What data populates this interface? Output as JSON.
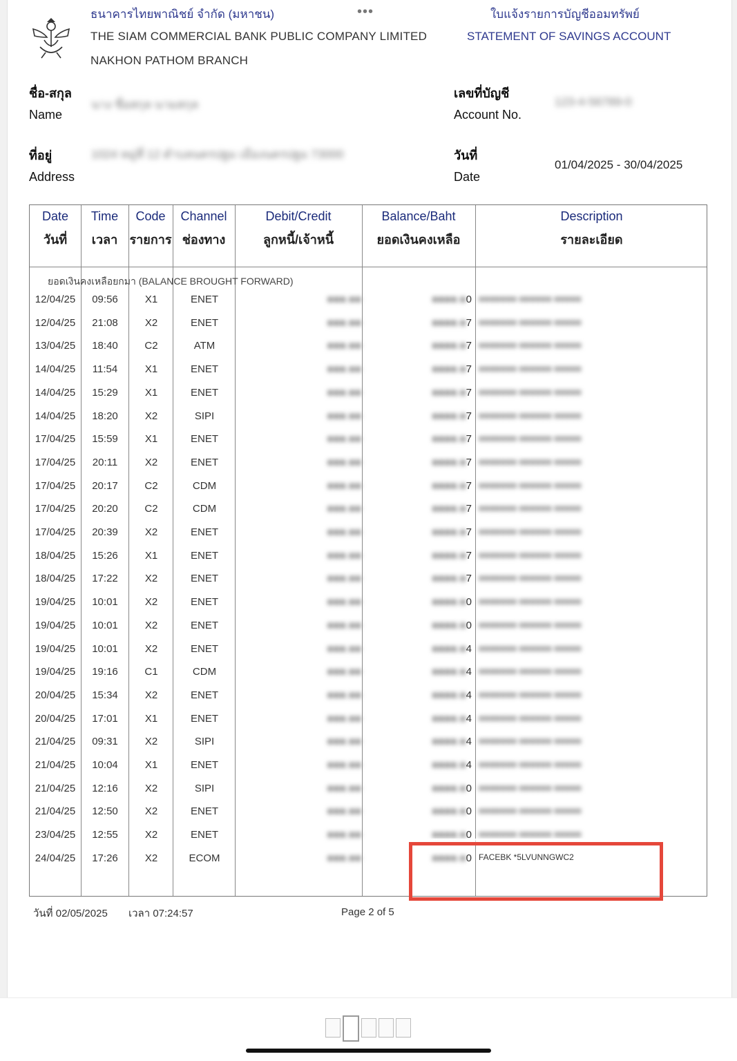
{
  "bank": {
    "name_th": "ธนาคารไทยพาณิชย์ จำกัด (มหาชน)",
    "name_en": "THE SIAM COMMERCIAL BANK PUBLIC COMPANY LIMITED",
    "branch": "NAKHON PATHOM BRANCH"
  },
  "doc_title": {
    "th": "ใบแจ้งรายการบัญชีออมทรัพย์",
    "en": "STATEMENT OF SAVINGS ACCOUNT"
  },
  "menu_dots": "•••",
  "labels": {
    "name_th": "ชื่อ-สกุล",
    "name_en": "Name",
    "address_th": "ที่อยู่",
    "address_en": "Address",
    "account_th": "เลขที่บัญชี",
    "account_en": "Account No.",
    "date_th": "วันที่",
    "date_en": "Date"
  },
  "values": {
    "name": "นาง ชื่อสกุล นามสกุล",
    "address": "1024 หมู่ที่ 12 ตำบลนครปฐม เมืองนครปฐม 73000",
    "account": "123-4-56789-0",
    "date_range": "01/04/2025 - 30/04/2025"
  },
  "table": {
    "headers": [
      {
        "en": "Date",
        "th": "วันที่"
      },
      {
        "en": "Time",
        "th": "เวลา"
      },
      {
        "en": "Code",
        "th": "รายการ"
      },
      {
        "en": "Channel",
        "th": "ช่องทาง"
      },
      {
        "en": "Debit/Credit",
        "th": "ลูกหนี้/เจ้าหนี้"
      },
      {
        "en": "Balance/Baht",
        "th": "ยอดเงินคงเหลือ"
      },
      {
        "en": "Description",
        "th": "รายละเอียด"
      }
    ],
    "brought_forward": "ยอดเงินคงเหลือยกมา (BALANCE BROUGHT FORWARD)",
    "rows": [
      {
        "date": "12/04/25",
        "time": "09:56",
        "code": "X1",
        "channel": "ENET",
        "balance_tail": "0"
      },
      {
        "date": "12/04/25",
        "time": "21:08",
        "code": "X2",
        "channel": "ENET",
        "balance_tail": "7"
      },
      {
        "date": "13/04/25",
        "time": "18:40",
        "code": "C2",
        "channel": "ATM",
        "balance_tail": "7"
      },
      {
        "date": "14/04/25",
        "time": "11:54",
        "code": "X1",
        "channel": "ENET",
        "balance_tail": "7"
      },
      {
        "date": "14/04/25",
        "time": "15:29",
        "code": "X1",
        "channel": "ENET",
        "balance_tail": "7"
      },
      {
        "date": "14/04/25",
        "time": "18:20",
        "code": "X2",
        "channel": "SIPI",
        "balance_tail": "7"
      },
      {
        "date": "17/04/25",
        "time": "15:59",
        "code": "X1",
        "channel": "ENET",
        "balance_tail": "7"
      },
      {
        "date": "17/04/25",
        "time": "20:11",
        "code": "X2",
        "channel": "ENET",
        "balance_tail": "7"
      },
      {
        "date": "17/04/25",
        "time": "20:17",
        "code": "C2",
        "channel": "CDM",
        "balance_tail": "7"
      },
      {
        "date": "17/04/25",
        "time": "20:20",
        "code": "C2",
        "channel": "CDM",
        "balance_tail": "7"
      },
      {
        "date": "17/04/25",
        "time": "20:39",
        "code": "X2",
        "channel": "ENET",
        "balance_tail": "7"
      },
      {
        "date": "18/04/25",
        "time": "15:26",
        "code": "X1",
        "channel": "ENET",
        "balance_tail": "7"
      },
      {
        "date": "18/04/25",
        "time": "17:22",
        "code": "X2",
        "channel": "ENET",
        "balance_tail": "7"
      },
      {
        "date": "19/04/25",
        "time": "10:01",
        "code": "X2",
        "channel": "ENET",
        "balance_tail": "0"
      },
      {
        "date": "19/04/25",
        "time": "10:01",
        "code": "X2",
        "channel": "ENET",
        "balance_tail": "0"
      },
      {
        "date": "19/04/25",
        "time": "10:01",
        "code": "X2",
        "channel": "ENET",
        "balance_tail": "4"
      },
      {
        "date": "19/04/25",
        "time": "19:16",
        "code": "C1",
        "channel": "CDM",
        "balance_tail": "4"
      },
      {
        "date": "20/04/25",
        "time": "15:34",
        "code": "X2",
        "channel": "ENET",
        "balance_tail": "4"
      },
      {
        "date": "20/04/25",
        "time": "17:01",
        "code": "X1",
        "channel": "ENET",
        "balance_tail": "4"
      },
      {
        "date": "21/04/25",
        "time": "09:31",
        "code": "X2",
        "channel": "SIPI",
        "balance_tail": "4"
      },
      {
        "date": "21/04/25",
        "time": "10:04",
        "code": "X1",
        "channel": "ENET",
        "balance_tail": "4"
      },
      {
        "date": "21/04/25",
        "time": "12:16",
        "code": "X2",
        "channel": "SIPI",
        "balance_tail": "0"
      },
      {
        "date": "21/04/25",
        "time": "12:50",
        "code": "X2",
        "channel": "ENET",
        "balance_tail": "0"
      },
      {
        "date": "23/04/25",
        "time": "12:55",
        "code": "X2",
        "channel": "ENET",
        "balance_tail": "0"
      },
      {
        "date": "24/04/25",
        "time": "17:26",
        "code": "X2",
        "channel": "ECOM",
        "balance_tail": "0",
        "description": "FACEBK *5LVUNNGWC2"
      }
    ]
  },
  "footer": {
    "print_date": "วันที่ 02/05/2025",
    "print_time": "เวลา 07:24:57",
    "page": "Page 2 of 5"
  },
  "colors": {
    "header_blue": "#2f3a8f",
    "highlight_red": "#e5473a"
  }
}
